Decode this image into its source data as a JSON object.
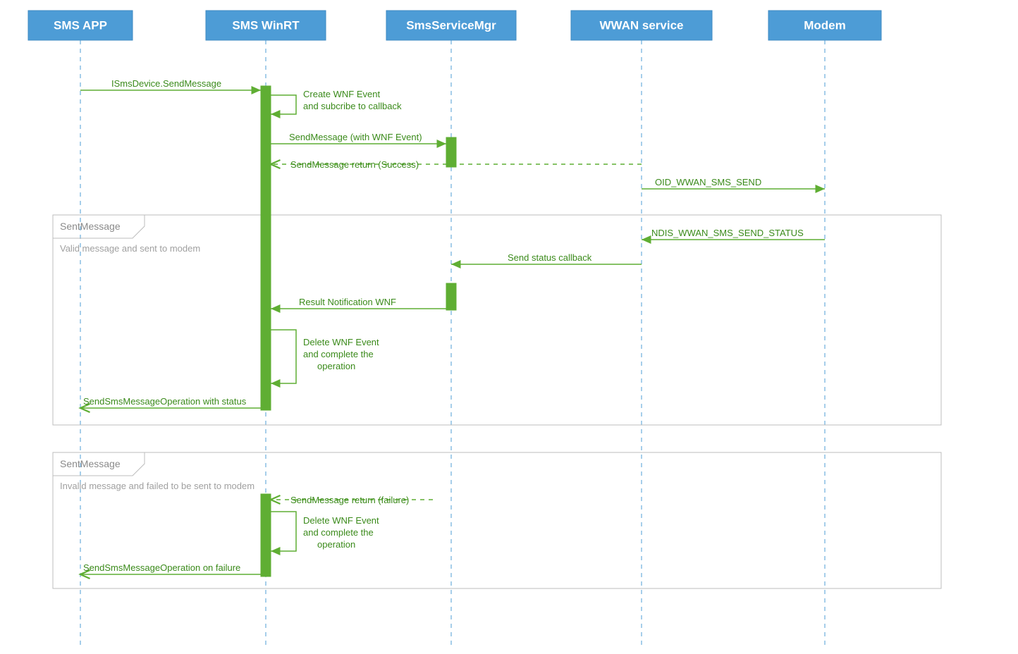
{
  "participants": {
    "p1": "SMS APP",
    "p2": "SMS WinRT",
    "p3": "SmsServiceMgr",
    "p4": "WWAN service",
    "p5": "Modem"
  },
  "messages": {
    "m1": "ISmsDevice.SendMessage",
    "m2a": "Create WNF Event",
    "m2b": "and subcribe to callback",
    "m3": "SendMessage (with WNF Event)",
    "m4": "SendMessage return (Success)",
    "m5": "OID_WWAN_SMS_SEND",
    "m6": "NDIS_WWAN_SMS_SEND_STATUS",
    "m7": "Send status callback",
    "m8": "Result Notification WNF",
    "m9a": "Delete WNF Event",
    "m9b": "and complete the",
    "m9c": "operation",
    "m10": "SendSmsMessageOperation with status",
    "m11": "SendMessage return (failure)",
    "m12a": "Delete WNF Event",
    "m12b": "and complete the",
    "m12c": "operation",
    "m13": "SendSmsMessageOperation on failure"
  },
  "fragments": {
    "f1_title": "SentMessage",
    "f1_desc": "Valid message and sent to modem",
    "f2_title": "SentMessage",
    "f2_desc": "Invalid message and failed to be sent to modem"
  }
}
